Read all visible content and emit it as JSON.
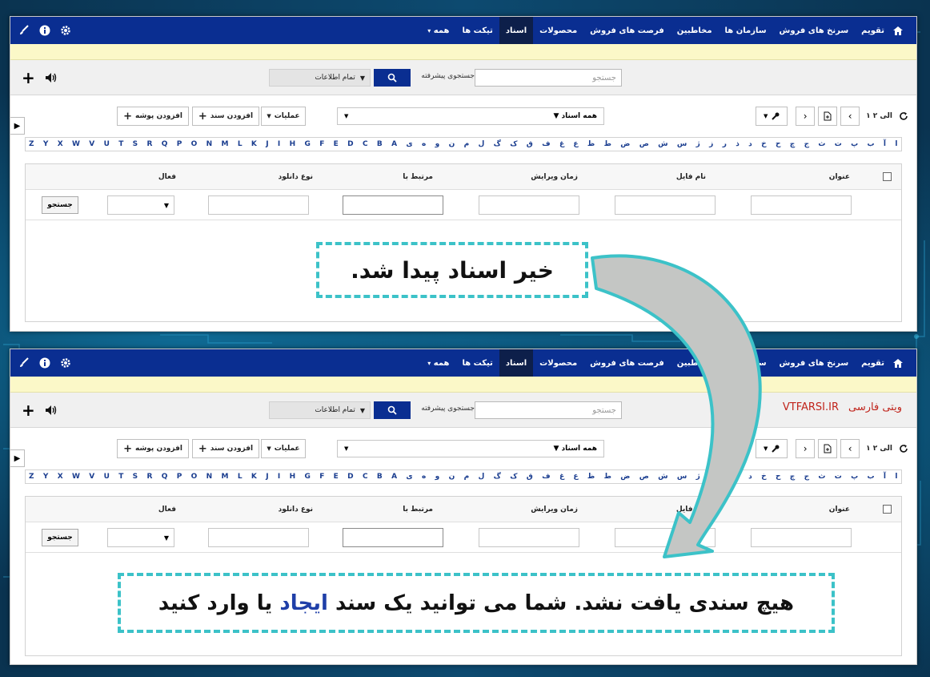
{
  "nav": {
    "items": [
      "تقویم",
      "سرنخ های فروش",
      "سازمان ها",
      "مخاطبین",
      "فرصت های فروش",
      "محصولات",
      "اسناد",
      "تیکت ها",
      "همه"
    ],
    "active_index": 6
  },
  "search": {
    "placeholder": "جستجو",
    "advanced_label": "جستجوی پیشرفته",
    "scope_value": "تمام اطلاعات"
  },
  "toolbar": {
    "add_folder": "افزودن پوشه",
    "add_document": "افزودن سند",
    "actions": "عملیات",
    "filter_value": "همه اسناد",
    "pager_text": "۱ الی ۲"
  },
  "alphabet": [
    "Z",
    "Y",
    "X",
    "W",
    "V",
    "U",
    "T",
    "S",
    "R",
    "Q",
    "P",
    "O",
    "N",
    "M",
    "L",
    "K",
    "J",
    "I",
    "H",
    "G",
    "F",
    "E",
    "D",
    "C",
    "B",
    "A",
    "ی",
    "ه",
    "و",
    "ن",
    "م",
    "ل",
    "گ",
    "ک",
    "ق",
    "ف",
    "غ",
    "ع",
    "ظ",
    "ط",
    "ض",
    "ص",
    "ش",
    "س",
    "ژ",
    "ز",
    "ر",
    "ذ",
    "د",
    "خ",
    "ح",
    "چ",
    "ج",
    "ث",
    "ت",
    "پ",
    "ب",
    "آ",
    "ا"
  ],
  "grid": {
    "columns": [
      "عنوان",
      "نام فایل",
      "زمان ویرایش",
      "مرتبط با",
      "نوع دانلود",
      "فعال"
    ],
    "search_button": "جستجو"
  },
  "watermark": {
    "fa": "ویتی فارسی",
    "en": "VTFARSI.IR"
  },
  "callouts": {
    "old_message": "خیر اسناد پیدا شد.",
    "new_message_part1": "هیچ سندی یافت نشد. شما می توانید یک سند ",
    "new_message_link": "ایجاد",
    "new_message_part2": " یا وارد کنید"
  },
  "colors": {
    "nav_bg": "#0a2e91",
    "nav_active": "#0d1f4a",
    "notice_bar": "#fbf8c8",
    "callout_border": "#3cc2c8",
    "link": "#1f3fa8",
    "watermark": "#c0241b"
  }
}
